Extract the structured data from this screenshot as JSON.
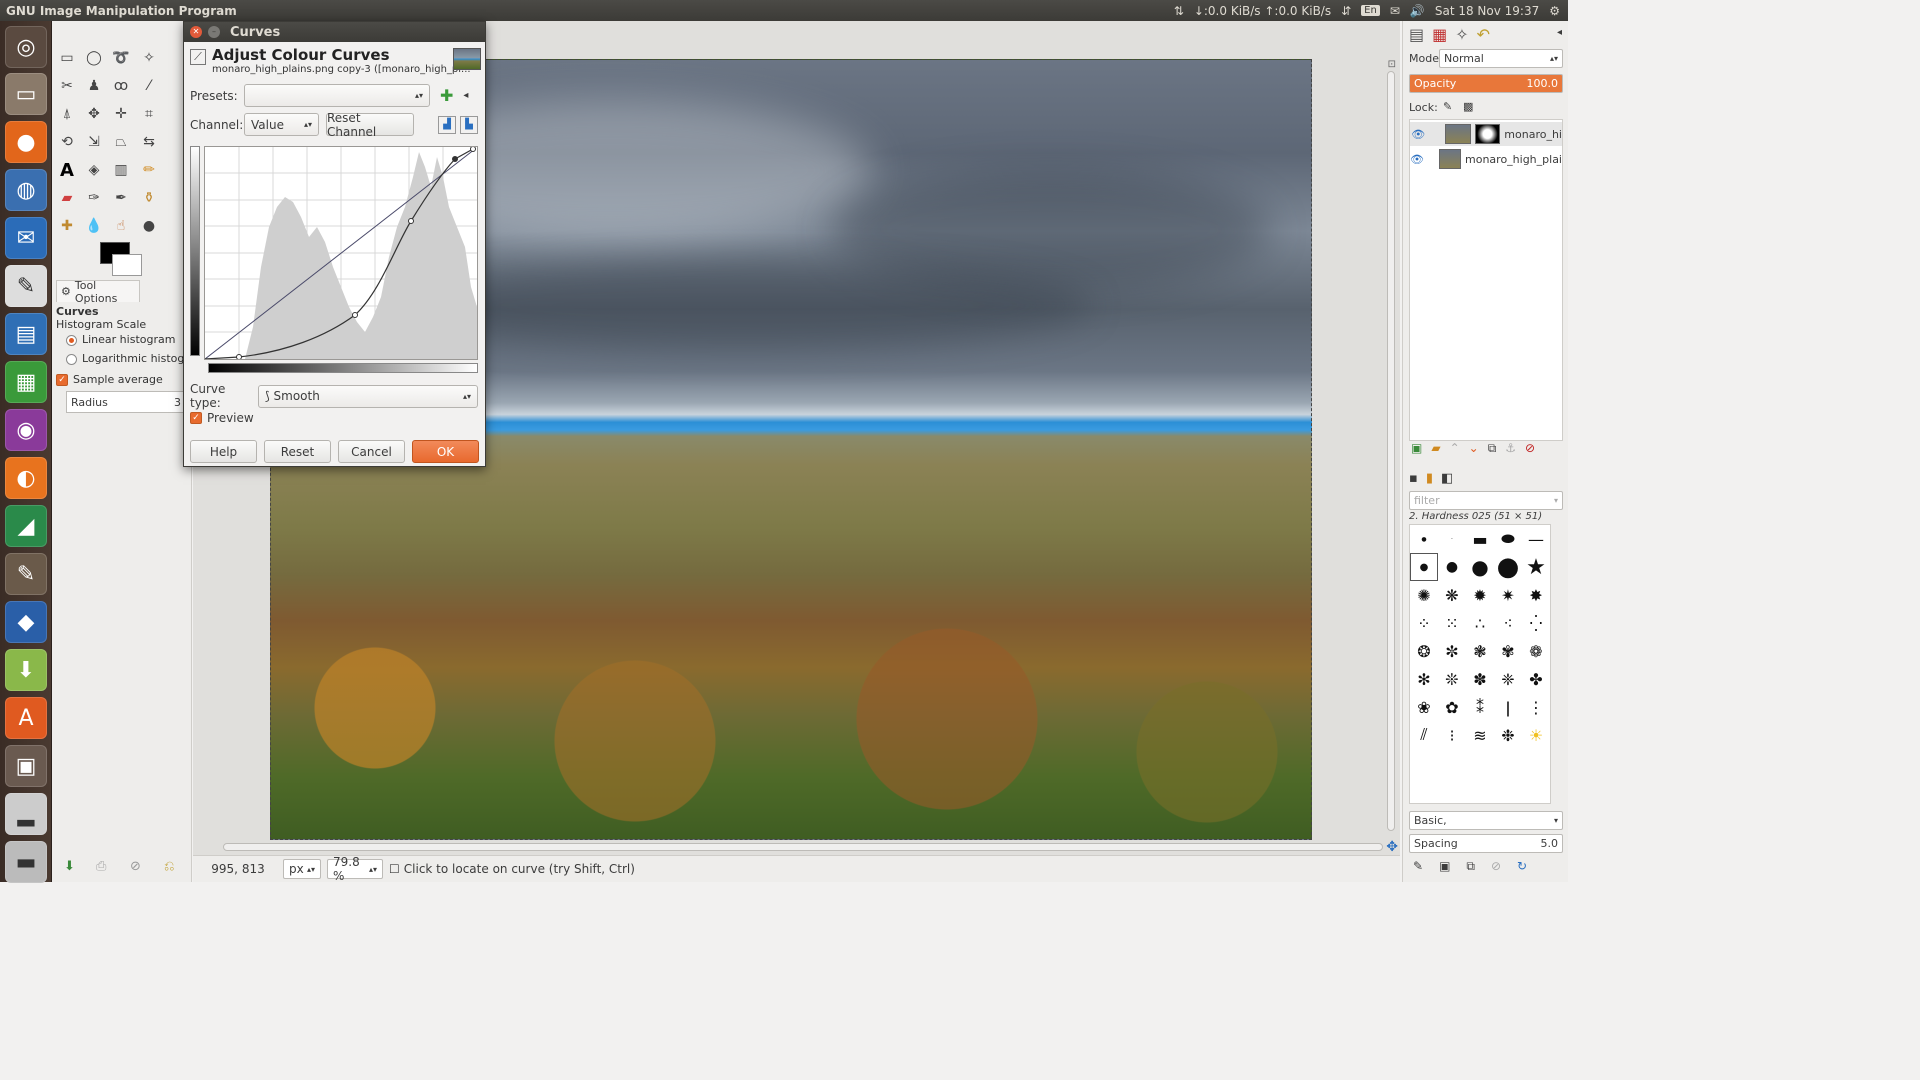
{
  "topbar": {
    "app_title": "GNU Image Manipulation Program",
    "network": "↓:0.0 KiB/s ↑:0.0 KiB/s",
    "lang": "En",
    "datetime": "Sat 18 Nov 19:37"
  },
  "toolbox": {
    "tool_options_tab": "Tool Options",
    "options_title": "Curves",
    "histogram_scale_label": "Histogram Scale",
    "linear_histogram": "Linear histogram",
    "log_histogram": "Logarithmic histogram",
    "sample_average": "Sample average",
    "radius_label": "Radius",
    "radius_value": "3"
  },
  "dialog": {
    "window_title": "Curves",
    "heading": "Adjust Colour Curves",
    "subheading": "monaro_high_plains.png copy-3 ([monaro_high_pl...",
    "presets_label": "Presets:",
    "channel_label": "Channel:",
    "channel_value": "Value",
    "reset_channel": "Reset Channel",
    "curve_type_label": "Curve type:",
    "curve_type_value": "Smooth",
    "preview_label": "Preview",
    "buttons": {
      "help": "Help",
      "reset": "Reset",
      "cancel": "Cancel",
      "ok": "OK"
    }
  },
  "statusbar": {
    "coords": "995, 813",
    "unit": "px",
    "zoom": "79.8 %",
    "message": "Click to locate on curve (try Shift, Ctrl)"
  },
  "layers": {
    "mode_label": "Mode:",
    "mode_value": "Normal",
    "opacity_label": "Opacity",
    "opacity_value": "100.0",
    "lock_label": "Lock:",
    "items": [
      {
        "name": "monaro_hi"
      },
      {
        "name": "monaro_high_plai"
      }
    ]
  },
  "brushes": {
    "filter_placeholder": "filter",
    "current_brush": "2. Hardness 025 (51 × 51)",
    "tag_value": "Basic,",
    "spacing_label": "Spacing",
    "spacing_value": "5.0"
  },
  "colors": {
    "accent": "#e86b2e",
    "titlebar": "#3c3b37",
    "sky_blue": "#2c8fd6"
  }
}
